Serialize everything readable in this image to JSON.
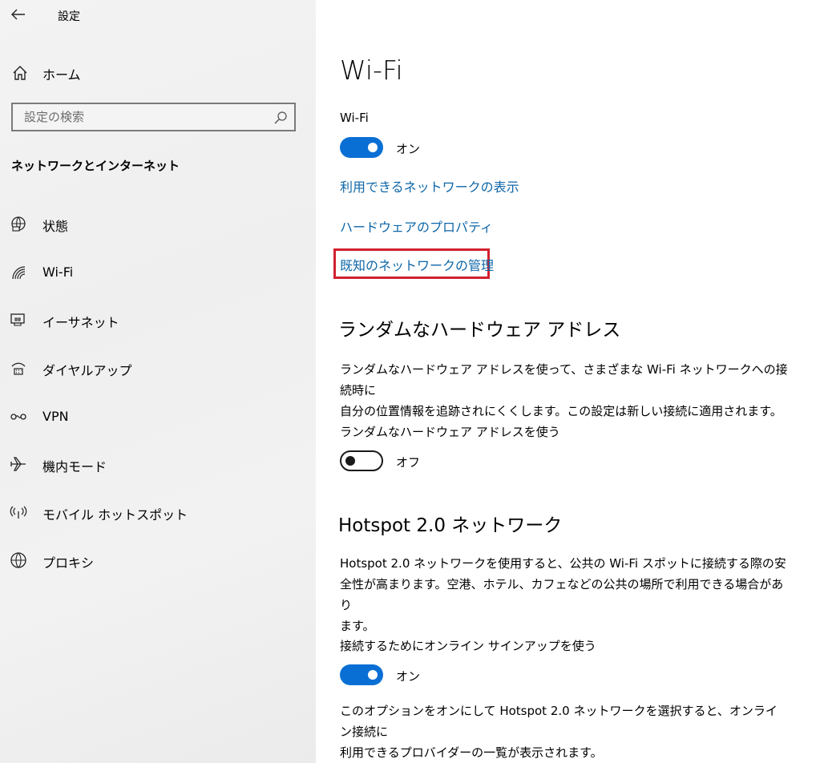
{
  "app": {
    "title": "設定"
  },
  "sidebar": {
    "home_label": "ホーム",
    "search_placeholder": "設定の検索",
    "section_title": "ネットワークとインターネット",
    "items": [
      {
        "label": "状態",
        "icon": "status-globe-icon"
      },
      {
        "label": "Wi-Fi",
        "icon": "wifi-icon"
      },
      {
        "label": "イーサネット",
        "icon": "ethernet-icon"
      },
      {
        "label": "ダイヤルアップ",
        "icon": "dialup-icon"
      },
      {
        "label": "VPN",
        "icon": "vpn-icon"
      },
      {
        "label": "機内モード",
        "icon": "airplane-icon"
      },
      {
        "label": "モバイル ホットスポット",
        "icon": "hotspot-icon"
      },
      {
        "label": "プロキシ",
        "icon": "globe-icon"
      }
    ]
  },
  "main": {
    "title": "Wi-Fi",
    "wifi": {
      "label": "Wi-Fi",
      "on": true,
      "state": "オン"
    },
    "links": {
      "available": "利用できるネットワークの表示",
      "hardware": "ハードウェアのプロパティ",
      "known": "既知のネットワークの管理"
    },
    "random_hw": {
      "heading": "ランダムなハードウェア アドレス",
      "desc_line1": "ランダムなハードウェア アドレスを使って、さまざまな Wi-Fi ネットワークへの接続時に",
      "desc_line2": "自分の位置情報を追跡されにくくします。この設定は新しい接続に適用されます。",
      "toggle_label": "ランダムなハードウェア アドレスを使う",
      "on": false,
      "state": "オフ"
    },
    "hotspot": {
      "heading": "Hotspot 2.0 ネットワーク",
      "desc_line1": "Hotspot 2.0 ネットワークを使用すると、公共の Wi-Fi スポットに接続する際の安",
      "desc_line2": "全性が高まります。空港、ホテル、カフェなどの公共の場所で利用できる場合があり",
      "desc_line3": "ます。",
      "toggle_label": "接続するためにオンライン サインアップを使う",
      "on": true,
      "state": "オン",
      "note_line1": "このオプションをオンにして Hotspot 2.0 ネットワークを選択すると、オンライン接続に",
      "note_line2": "利用できるプロバイダーの一覧が表示されます。"
    }
  },
  "colors": {
    "accent": "#0a6fd4",
    "link": "#0e66a8",
    "highlight": "#d2202e"
  }
}
